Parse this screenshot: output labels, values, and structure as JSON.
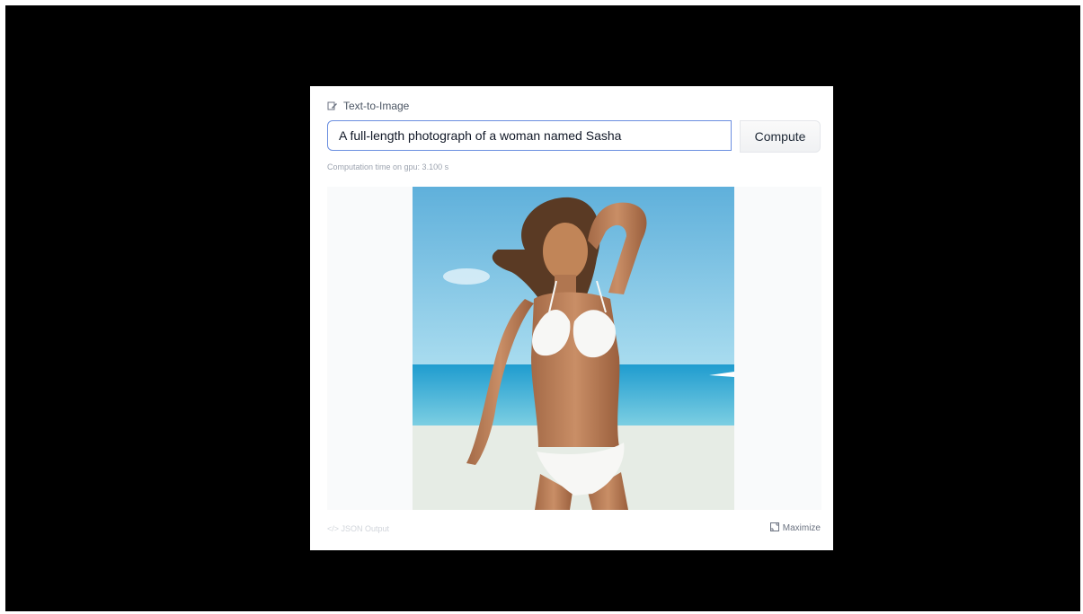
{
  "widget": {
    "header_label": "Text-to-Image",
    "header_icon": "edit-icon",
    "prompt_value": "A full-length photograph of a woman named Sasha",
    "compute_label": "Compute",
    "computation_time": "Computation time on gpu: 3.100 s",
    "json_output_label": "</> JSON Output",
    "maximize_label": "Maximize",
    "maximize_icon": "maximize-icon"
  },
  "colors": {
    "background": "#000000",
    "panel": "#ffffff",
    "input_border": "#6b8fe0",
    "sky": "#7ec4e6",
    "sea": "#2fa9d6",
    "sand": "#e9eee6"
  }
}
